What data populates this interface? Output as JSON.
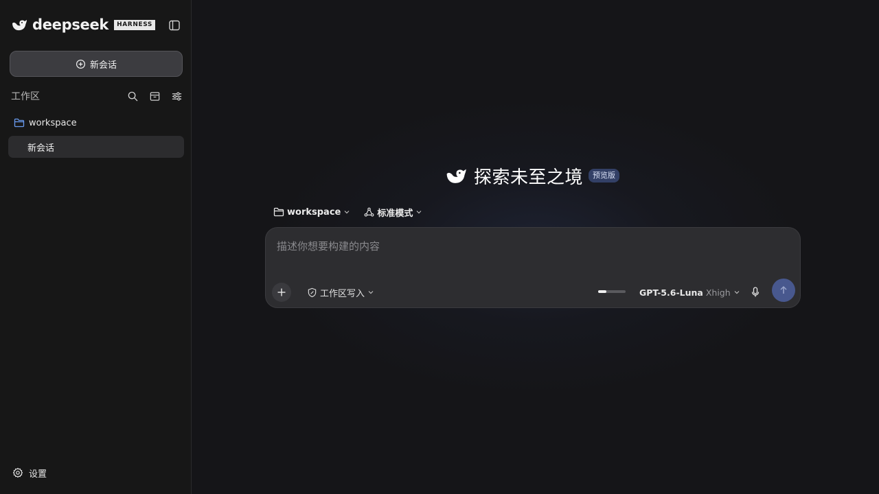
{
  "sidebar": {
    "brand_name": "deepseek",
    "brand_badge": "HARNESS",
    "new_chat_label": "新会话",
    "workspace_section_title": "工作区",
    "folder_name": "workspace",
    "sessions": [
      {
        "label": "新会话"
      }
    ],
    "settings_label": "设置"
  },
  "main": {
    "hero_title": "探索未至之境",
    "preview_badge": "预览版",
    "folder_selector": "workspace",
    "mode_selector": "标准模式",
    "composer": {
      "placeholder": "描述你想要构建的内容",
      "value": "",
      "permission_label": "工作区写入",
      "model_name": "GPT-5.6-Luna",
      "reasoning_level": "Xhigh",
      "effort_fraction": 0.3
    }
  },
  "colors": {
    "accent": "#48588e",
    "folder_icon": "#6a9cf0",
    "preview_badge_bg": "#334066",
    "sidebar_bg": "#171717",
    "main_bg": "#151518"
  },
  "icons": [
    "whale-logo-icon",
    "sidebar-toggle-icon",
    "plus-circle-icon",
    "search-icon",
    "archive-icon",
    "sliders-icon",
    "folder-icon",
    "gear-icon",
    "chevron-down-icon",
    "mode-icon",
    "shield-edit-icon",
    "plus-icon",
    "mic-icon",
    "arrow-up-icon"
  ]
}
